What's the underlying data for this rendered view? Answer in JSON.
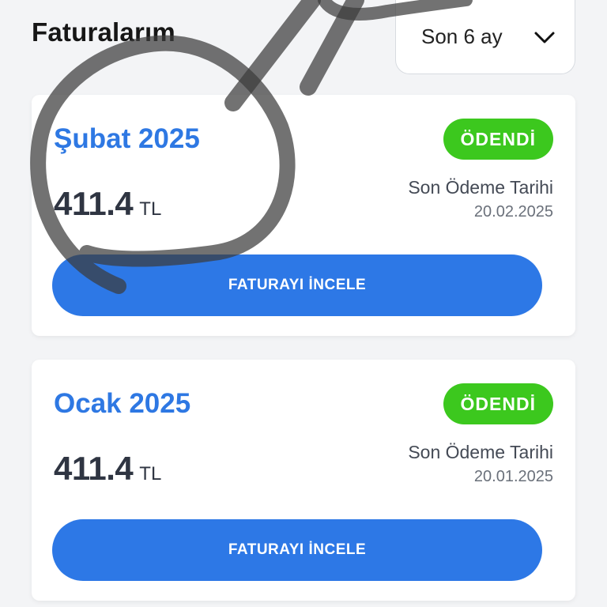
{
  "header": {
    "title": "Faturalarım"
  },
  "period_filter": {
    "selected": "Son 6 ay",
    "icon": "chevron-down-icon"
  },
  "invoices": [
    {
      "month": "Şubat 2025",
      "status": "ÖDENDİ",
      "amount": "411.4",
      "currency": "TL",
      "due_label": "Son Ödeme Tarihi",
      "due_date": "20.02.2025",
      "action": "FATURAYI İNCELE"
    },
    {
      "month": "Ocak 2025",
      "status": "ÖDENDİ",
      "amount": "411.4",
      "currency": "TL",
      "due_label": "Son Ödeme Tarihi",
      "due_date": "20.01.2025",
      "action": "FATURAYI İNCELE"
    }
  ],
  "colors": {
    "accent_blue": "#2d78e6",
    "paid_green": "#3cc81e",
    "scribble": "#3c3c3c"
  }
}
